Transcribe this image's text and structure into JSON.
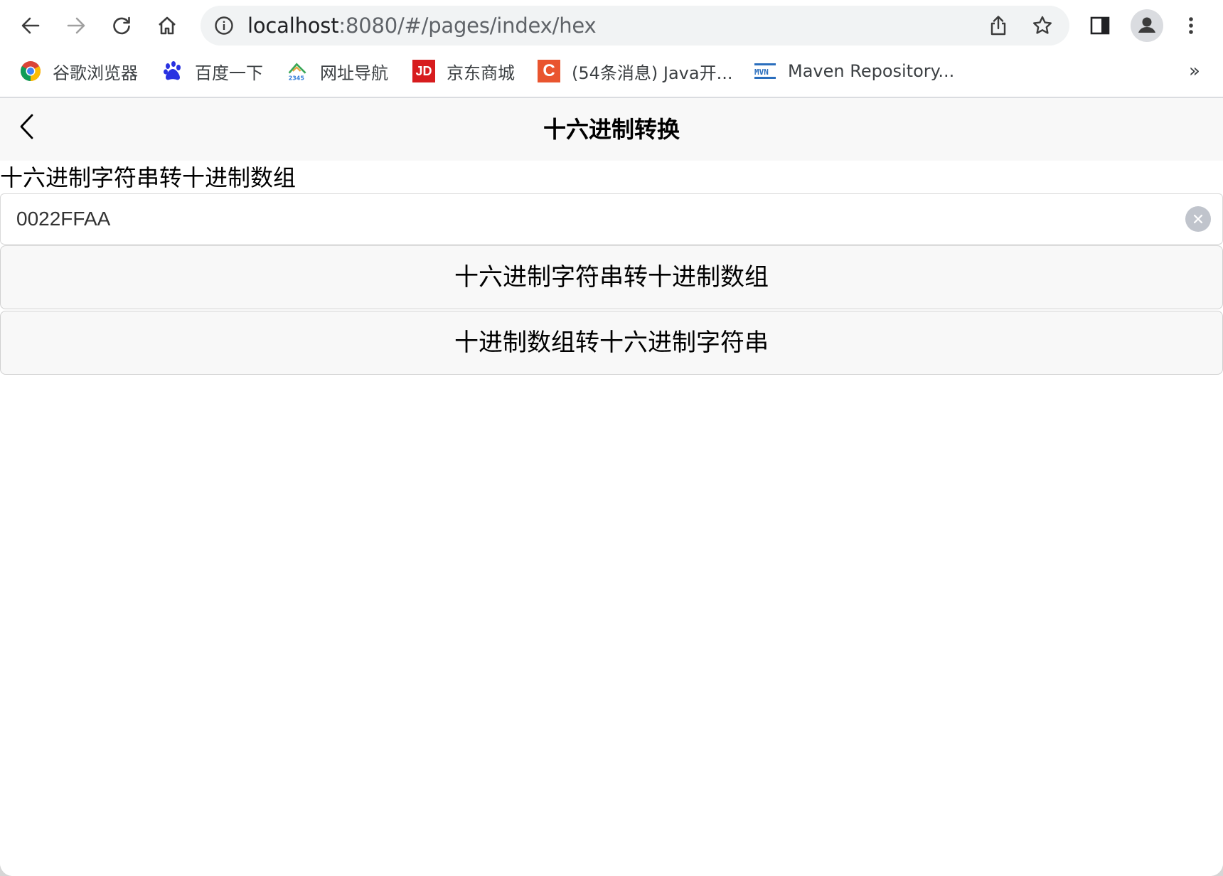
{
  "browser": {
    "url_host": "localhost",
    "url_rest": ":8080/#/pages/index/hex",
    "bookmarks": [
      {
        "label": "谷歌浏览器",
        "icon": "chrome-icon"
      },
      {
        "label": "百度一下",
        "icon": "baidu-paw-icon"
      },
      {
        "label": "网址导航",
        "icon": "2345-icon"
      },
      {
        "label": "京东商城",
        "icon": "jd-icon",
        "icon_text": "JD"
      },
      {
        "label": "(54条消息) Java开...",
        "icon": "csdn-icon",
        "icon_text": "C"
      },
      {
        "label": "Maven Repository...",
        "icon": "mvn-icon",
        "icon_text": "MVN"
      }
    ],
    "more_label": "»"
  },
  "app": {
    "title": "十六进制转换",
    "section_label": "十六进制字符串转十进制数组",
    "input_value": "0022FFAA",
    "buttons": {
      "hex_to_dec": "十六进制字符串转十进制数组",
      "dec_to_hex": "十进制数组转十六进制字符串"
    }
  }
}
